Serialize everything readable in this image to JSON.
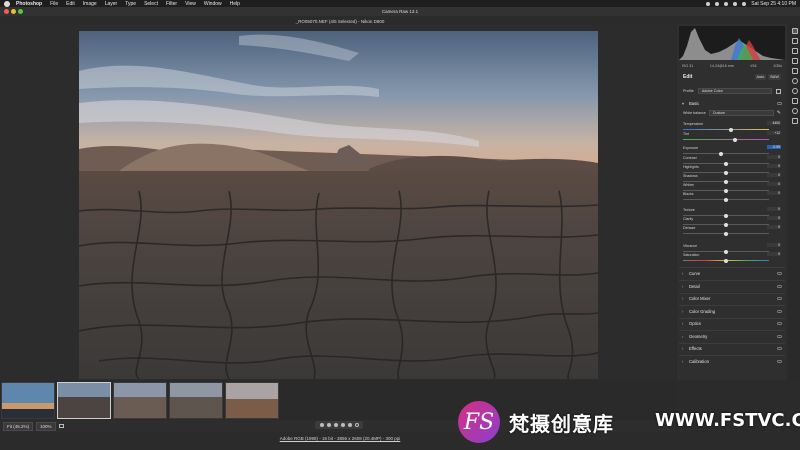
{
  "menubar": {
    "app": "Photoshop",
    "items": [
      "File",
      "Edit",
      "Image",
      "Layer",
      "Type",
      "Select",
      "Filter",
      "View",
      "Window",
      "Help"
    ],
    "clock": "Sat Sep 25  4:10 PM"
  },
  "window": {
    "title": "Camera Raw 13.1"
  },
  "file": {
    "title": "_RO05070.NEF (4/5 Selected)  -  Nikon D800"
  },
  "camera_info": {
    "iso": "ISO 31",
    "lens": "14-24@16 mm",
    "aperture": "f/16",
    "shutter": "1/30s"
  },
  "edit": {
    "title": "Edit",
    "auto_label": "Auto",
    "bw_label": "B&W"
  },
  "profile": {
    "label": "Profile",
    "value": "Adobe Color"
  },
  "sections": {
    "basic": "Basic",
    "curve": "Curve",
    "detail": "Detail",
    "color_mixer": "Color Mixer",
    "color_grading": "Color Grading",
    "optics": "Optics",
    "geometry": "Geometry",
    "effects": "Effects",
    "calibration": "Calibration"
  },
  "white_balance": {
    "label": "White balance",
    "value": "Custom"
  },
  "sliders": {
    "temperature": {
      "label": "Temperature",
      "value": "4400",
      "pos": 0.56
    },
    "tint": {
      "label": "Tint",
      "value": "+12",
      "pos": 0.6
    },
    "exposure": {
      "label": "Exposure",
      "value": "-0.59",
      "pos": 0.44
    },
    "contrast": {
      "label": "Contrast",
      "value": "0",
      "pos": 0.5
    },
    "highlights": {
      "label": "Highlights",
      "value": "0",
      "pos": 0.5
    },
    "shadows": {
      "label": "Shadows",
      "value": "0",
      "pos": 0.5
    },
    "whites": {
      "label": "Whites",
      "value": "0",
      "pos": 0.5
    },
    "blacks": {
      "label": "Blacks",
      "value": "0",
      "pos": 0.5
    },
    "texture": {
      "label": "Texture",
      "value": "0",
      "pos": 0.5
    },
    "clarity": {
      "label": "Clarity",
      "value": "0",
      "pos": 0.5
    },
    "dehaze": {
      "label": "Dehaze",
      "value": "0",
      "pos": 0.5
    },
    "vibrance": {
      "label": "Vibrance",
      "value": "0",
      "pos": 0.5
    },
    "saturation": {
      "label": "Saturation",
      "value": "0",
      "pos": 0.5
    }
  },
  "bottom": {
    "fit_label": "Fit (45.2%)",
    "zoom_value": "100%",
    "footer_info": "Adobe RGB (1998) - 16 bit - 3856 x 2608 (20.4MP) - 300 ppi"
  },
  "watermark": {
    "logo": "FS",
    "text": "梵摄创意库",
    "url": "WWW.FSTVC.CC"
  },
  "colors": {
    "accent": "#2d5fb0",
    "panel": "#2f2f2f",
    "background": "#2b2b2b"
  }
}
